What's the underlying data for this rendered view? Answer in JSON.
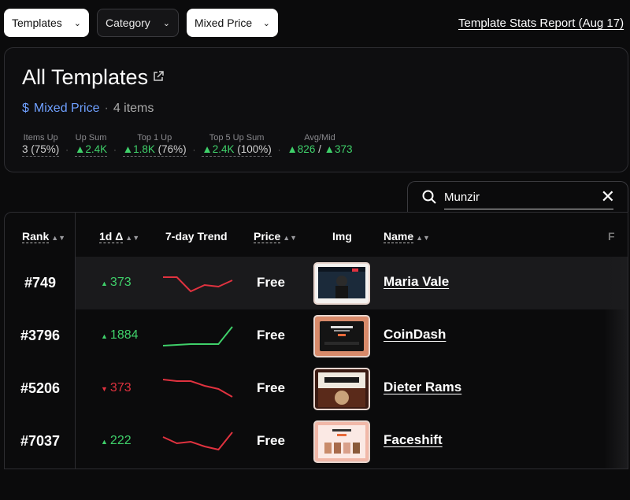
{
  "filters": {
    "templates_label": "Templates",
    "category_label": "Category",
    "price_label": "Mixed Price"
  },
  "report_link": "Template Stats Report (Aug 17)",
  "summary": {
    "title": "All Templates",
    "price_symbol": "$",
    "price_mode": "Mixed Price",
    "item_count": "4 items",
    "stats": [
      {
        "label": "Items Up",
        "value": "3 (75%)",
        "tone": "neutral"
      },
      {
        "label": "Up Sum",
        "value": "▲2.4K",
        "tone": "green"
      },
      {
        "label": "Top 1 Up",
        "value": "▲1.8K",
        "extra": " (76%)",
        "tone": "green"
      },
      {
        "label": "Top 5 Up Sum",
        "value": "▲2.4K",
        "extra": " (100%)",
        "tone": "green"
      },
      {
        "label": "Avg/Mid",
        "value": "▲826",
        "extra": " / ",
        "value2": "▲373",
        "tone": "green"
      }
    ]
  },
  "search": {
    "value": "Munzir"
  },
  "table": {
    "headers": {
      "rank": "Rank",
      "delta": "1d Δ",
      "trend": "7-day Trend",
      "price": "Price",
      "img": "Img",
      "name": "Name",
      "next": "F"
    },
    "rows": [
      {
        "rank": "#749",
        "delta": "373",
        "direction": "up",
        "price": "Free",
        "name": "Maria Vale",
        "trend_color": "#e0323f",
        "trend": [
          14,
          14,
          32,
          24,
          26,
          18
        ]
      },
      {
        "rank": "#3796",
        "delta": "1884",
        "direction": "up",
        "price": "Free",
        "name": "CoinDash",
        "trend_color": "#3fd06a",
        "trend": [
          34,
          33,
          32,
          32,
          32,
          10
        ]
      },
      {
        "rank": "#5206",
        "delta": "373",
        "direction": "down",
        "price": "Free",
        "name": "Dieter Rams",
        "trend_color": "#e0323f",
        "trend": [
          10,
          12,
          12,
          18,
          22,
          32
        ]
      },
      {
        "rank": "#7037",
        "delta": "222",
        "direction": "up",
        "price": "Free",
        "name": "Faceshift",
        "trend_color": "#e0323f",
        "trend": [
          16,
          24,
          22,
          28,
          32,
          10
        ]
      }
    ]
  },
  "colors": {
    "accent": "#6fa0ff",
    "up": "#3fd06a",
    "down": "#e0323f"
  }
}
